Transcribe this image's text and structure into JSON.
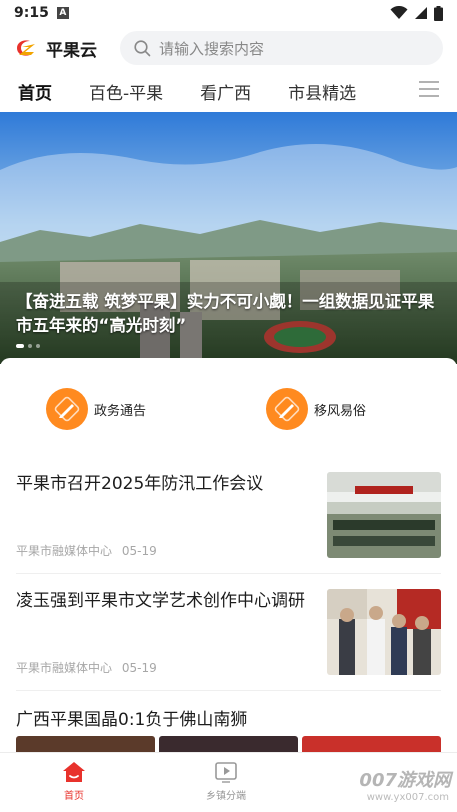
{
  "status_bar": {
    "time": "9:15",
    "badge": "A"
  },
  "header": {
    "app_name": "平果云",
    "search_placeholder": "请输入搜索内容"
  },
  "tabs": [
    {
      "label": "首页",
      "active": true
    },
    {
      "label": "百色-平果",
      "active": false
    },
    {
      "label": "看广西",
      "active": false
    },
    {
      "label": "市县精选",
      "active": false
    }
  ],
  "hero": {
    "title": "【奋进五载 筑梦平果】实力不可小觑！一组数据见证平果市五年来的“高光时刻”",
    "slide_count": 3,
    "active_slide": 0
  },
  "services": [
    {
      "label": "政务通告",
      "icon": "pencil-ruler-icon"
    },
    {
      "label": "移风易俗",
      "icon": "pencil-ruler-icon"
    }
  ],
  "news": [
    {
      "title": "平果市召开2025年防汛工作会议",
      "source": "平果市融媒体中心",
      "date": "05-19"
    },
    {
      "title": "凌玉强到平果市文学艺术创作中心调研",
      "source": "平果市融媒体中心",
      "date": "05-19"
    },
    {
      "title": "广西平果国晶0:1负于佛山南狮"
    }
  ],
  "bottom_nav": [
    {
      "label": "首页",
      "icon": "home-icon",
      "active": true
    },
    {
      "label": "乡镇分端",
      "icon": "video-play-icon",
      "active": false
    }
  ],
  "watermark": {
    "text": "007游戏网",
    "sub": "www.yx007.com"
  },
  "colors": {
    "accent": "#e8322c",
    "service_orange": "#ff8a1f"
  }
}
